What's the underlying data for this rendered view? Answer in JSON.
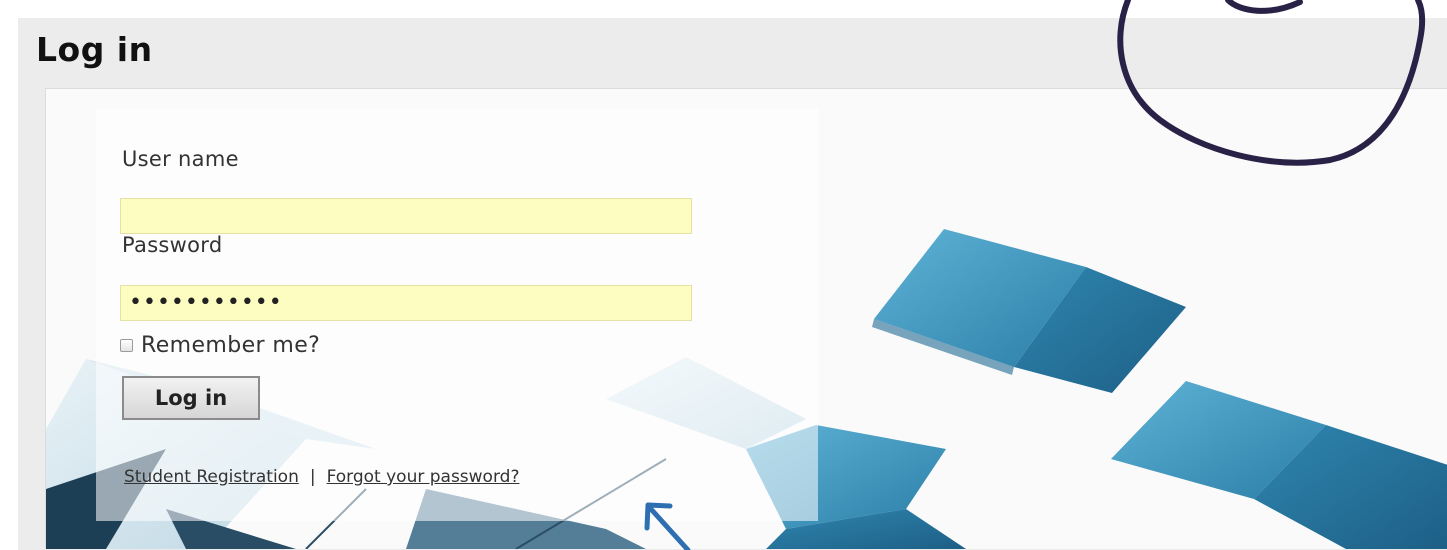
{
  "page": {
    "title": "Log in"
  },
  "form": {
    "username_label": "User name",
    "username_value": "",
    "password_label": "Password",
    "password_value": "•••••••••••",
    "remember_label": "Remember me?",
    "remember_checked": false,
    "submit_label": "Log in"
  },
  "links": {
    "student_registration": "Student Registration",
    "separator": "|",
    "forgot_password": "Forgot your password?"
  },
  "colors": {
    "field_background": "#fdfdc2",
    "annotation_circle": "#2a2147",
    "annotation_arrow": "#2d6fb0",
    "tile_blue": "#3c94bd"
  }
}
